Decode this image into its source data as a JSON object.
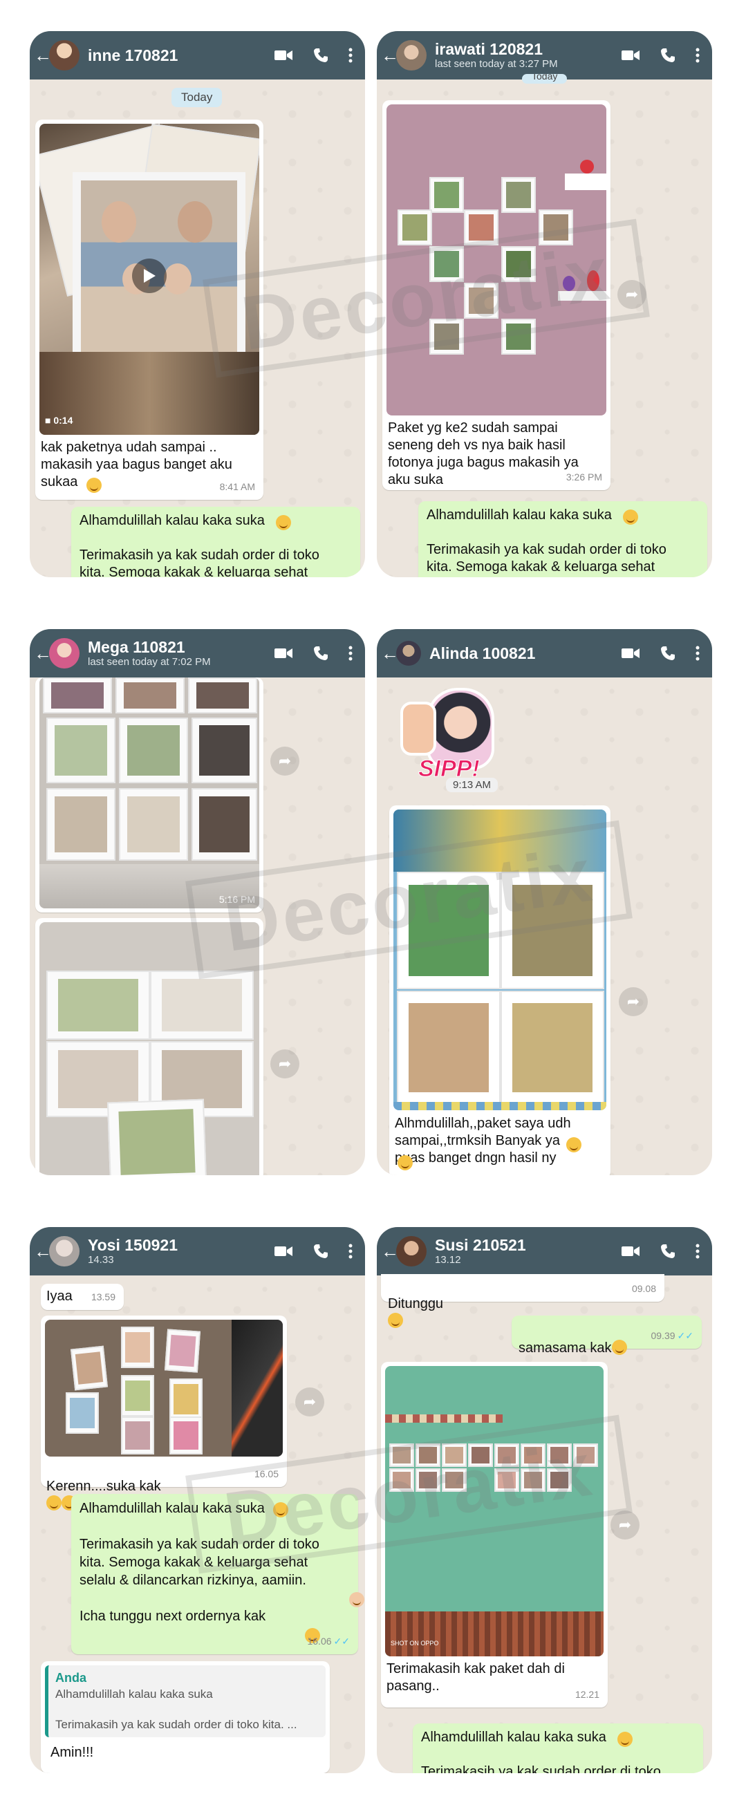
{
  "watermark": "Decoratix",
  "icons": [
    "video-call-icon",
    "phone-icon",
    "more-options-icon",
    "back-arrow-icon",
    "play-icon",
    "forward-icon",
    "double-check-icon"
  ],
  "colors": {
    "header": "#455a64",
    "chat_bg": "#ece5dd",
    "outgoing": "#dcf8c6",
    "incoming": "#ffffff",
    "read_ticks": "#4fc3f7",
    "quote_accent": "#1b998b"
  },
  "chats": {
    "inne": {
      "name": "inne 170821",
      "date_chip": "Today",
      "video_duration": "0:14",
      "in_msg": "kak paketnya udah sampai ..\nmakasih yaa bagus banget aku\nsukaa",
      "in_time": "8:41 AM",
      "out_msg": "Alhamdulillah kalau kaka suka\n\nTerimakasih ya kak sudah order di toko\nkita. Semoga kakak & keluarga sehat"
    },
    "irawati": {
      "name": "irawati 120821",
      "status": "last seen today at 3:27 PM",
      "date_chip": "Today",
      "in_msg": "Paket yg ke2 sudah sampai\nseneng deh vs nya baik hasil\nfotonya juga bagus makasih ya\naku suka",
      "in_time": "3:26 PM",
      "out_msg": "Alhamdulillah kalau kaka suka\n\nTerimakasih ya kak sudah order di toko\nkita. Semoga kakak & keluarga sehat"
    },
    "mega": {
      "name": "Mega 110821",
      "status": "last seen today at 7:02 PM",
      "photo_time": "5:16 PM"
    },
    "alinda": {
      "name": "Alinda 100821",
      "sticker_text": "SIPP!",
      "sticker_time": "9:13 AM",
      "in_msg": "Alhmdulillah,,paket saya udh\nsampai,,trmksih Banyak ya\n puas banget dngn hasil ny"
    },
    "yosi": {
      "name": "Yosi 150921",
      "status": "14.33",
      "msg1": "Iyaa",
      "msg1_time": "13.59",
      "photo_caption": "Kerenn....suka kak",
      "photo_time": "16.05",
      "out_msg": "Alhamdulillah kalau kaka suka\n\nTerimakasih ya kak sudah order di toko\nkita. Semoga kakak & keluarga sehat\nselalu & dilancarkan rizkinya, aamiin.\n\nIcha tunggu next ordernya kak",
      "out_time": "16.06",
      "quote_name": "Anda",
      "quote_text": "Alhamdulillah kalau kaka suka\n\nTerimakasih ya kak sudah order di toko kita. ...",
      "reply": "Amin!!!"
    },
    "susi": {
      "name": "Susi 210521",
      "status": "13.12",
      "msg1": "Ditunggu",
      "msg1_time": "09.08",
      "out1": "samasama kak",
      "out1_time": "09.39",
      "camera_tag": "SHOT ON OPPO",
      "photo_caption": "Terimakasih kak paket dah di\npasang..",
      "photo_time": "12.21",
      "out_msg": "Alhamdulillah kalau kaka suka\n\nTerimakasih ya kak sudah order di toko"
    }
  }
}
